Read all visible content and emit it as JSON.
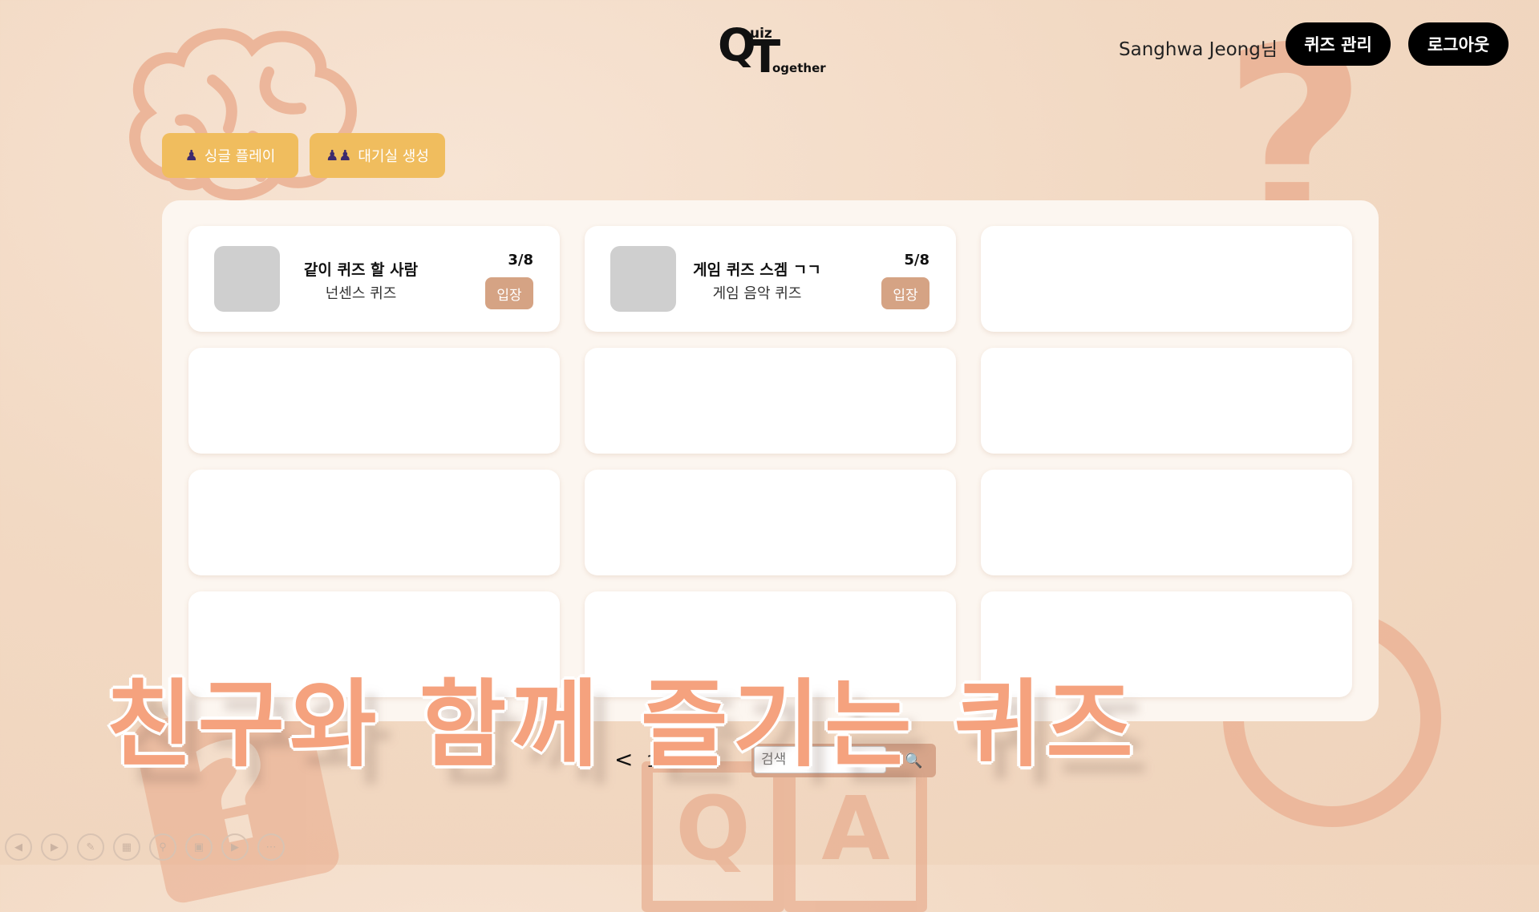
{
  "header": {
    "logo": {
      "q": "Q",
      "t": "T",
      "uiz": "uiz",
      "ogether": "ogether"
    },
    "user_name": "Sanghwa Jeong님",
    "manage_label": "퀴즈 관리",
    "logout_label": "로그아웃"
  },
  "actions": {
    "single_label": "싱글 플레이",
    "room_label": "대기실 생성"
  },
  "rooms": [
    {
      "title": "같이 퀴즈 할 사람",
      "subtitle": "넌센스 퀴즈",
      "count": "3/8",
      "enter_label": "입장"
    },
    {
      "title": "게임 퀴즈 스겜 ㄱㄱ",
      "subtitle": "게임 음악 퀴즈",
      "count": "5/8",
      "enter_label": "입장"
    }
  ],
  "pagination": {
    "prev": "<",
    "page": "1/1",
    "next": ">"
  },
  "search": {
    "placeholder": "검색",
    "icon": "search-icon"
  },
  "slogan": "친구와 함께 즐기는 퀴즈",
  "background": {
    "qcard_glyph": "?",
    "qmark_glyph": "?",
    "tile_q": "Q",
    "tile_a": "A"
  },
  "colors": {
    "accent_yellow": "#f0bd5e",
    "enter_button": "#d5a384",
    "header_button": "#000000",
    "slogan": "#f5a27e"
  }
}
